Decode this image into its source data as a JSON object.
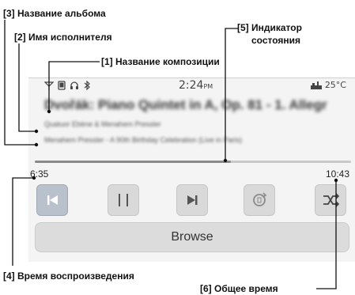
{
  "callouts": {
    "album": "[3] Название альбома",
    "artist": "[2] Имя исполнителя",
    "title": "[1] Название композиции",
    "status_line1": "[5] Индикатор",
    "status_line2": "состояния",
    "elapsed": "[4] Время воспроизведения",
    "total": "[6] Общее время"
  },
  "statusbar": {
    "icons": [
      "signal-icon",
      "phone-icon",
      "headphones-icon",
      "bluetooth-icon"
    ],
    "time": "2:24",
    "time_suffix": "PM",
    "temperature": "25°C"
  },
  "track": {
    "title": "Dvořák: Piano Quintet in A, Op. 81 - 1. Allegr",
    "artist": "Quatuor Ebène & Menahem Pressler",
    "album": "Menahem Pressler - A 90th Birthday Celebration (Live in Paris)"
  },
  "playback": {
    "elapsed": "6:35",
    "total": "10:43",
    "progress_fraction": 0.62
  },
  "controls": [
    "previous-track",
    "pause",
    "next-track",
    "repeat",
    "shuffle"
  ],
  "browse_label": "Browse",
  "colors": {
    "accent_button": "#b9c2cc",
    "button": "#d9d9d9",
    "screen_bg": "#f4f4f4"
  }
}
